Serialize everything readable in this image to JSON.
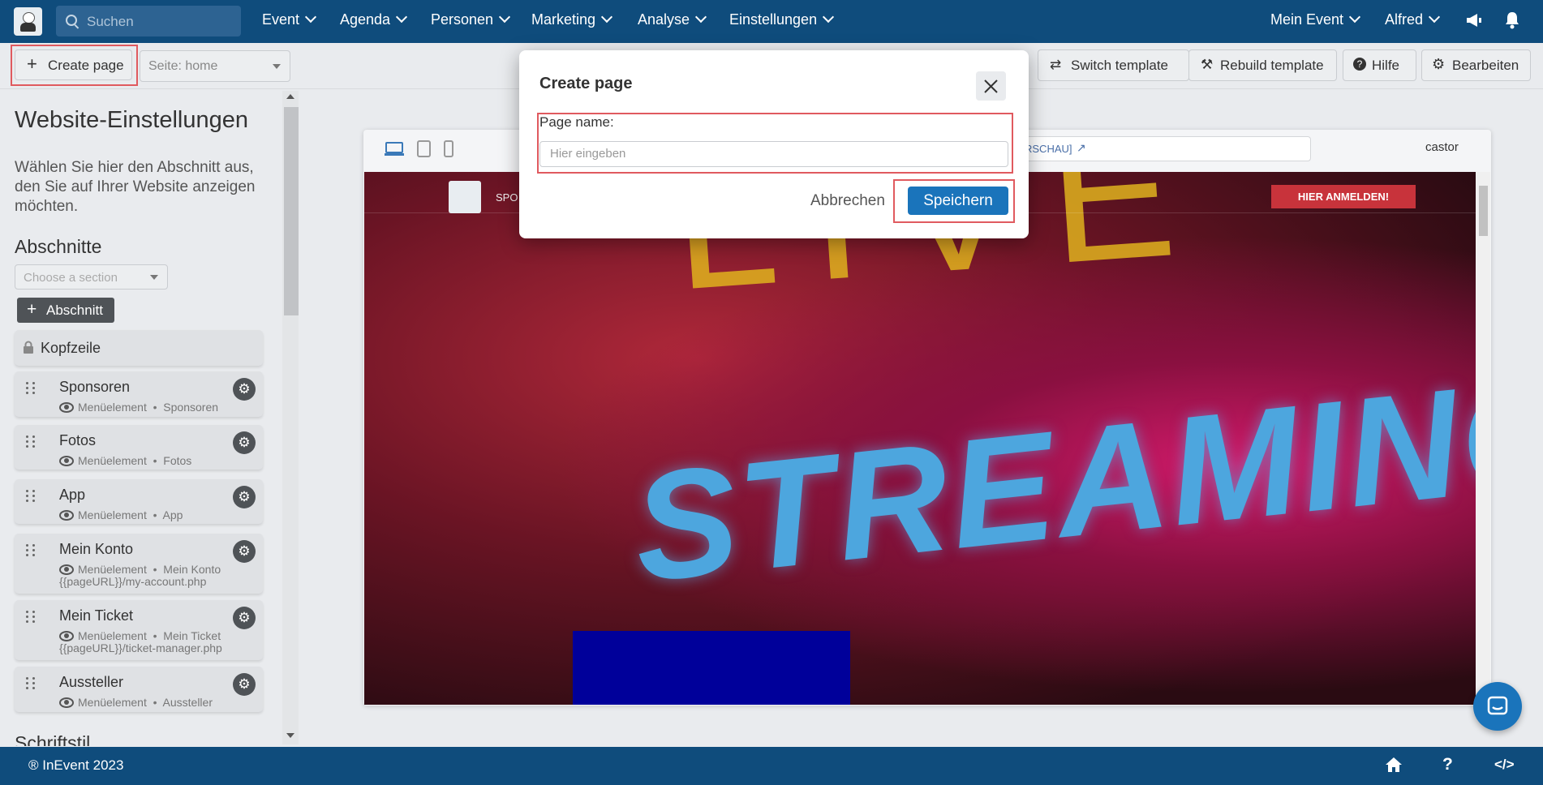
{
  "topbar": {
    "search_placeholder": "Suchen",
    "nav": [
      "Event",
      "Agenda",
      "Personen",
      "Marketing",
      "Analyse",
      "Einstellungen"
    ],
    "right": [
      "Mein Event",
      "Alfred"
    ]
  },
  "toolbar": {
    "create_page": "Create page",
    "page_select": "Seite: home",
    "switch_template": "Switch template",
    "rebuild_template": "Rebuild template",
    "help": "Hilfe",
    "edit": "Bearbeiten"
  },
  "sidebar": {
    "title": "Website-Einstellungen",
    "description": "Wählen Sie hier den Abschnitt aus, den Sie auf Ihrer Website anzeigen möchten.",
    "sections_heading": "Abschnitte",
    "section_select_placeholder": "Choose a section",
    "add_section": "Abschnitt",
    "header_item": "Kopfzeile",
    "items": [
      {
        "title": "Sponsoren",
        "type": "Menüelement",
        "target": "Sponsoren",
        "url": ""
      },
      {
        "title": "Fotos",
        "type": "Menüelement",
        "target": "Fotos",
        "url": ""
      },
      {
        "title": "App",
        "type": "Menüelement",
        "target": "App",
        "url": ""
      },
      {
        "title": "Mein Konto",
        "type": "Menüelement",
        "target": "Mein Konto",
        "url": "{{pageURL}}/my-account.php"
      },
      {
        "title": "Mein Ticket",
        "type": "Menüelement",
        "target": "Mein Ticket",
        "url": "{{pageURL}}/ticket-manager.php"
      },
      {
        "title": "Aussteller",
        "type": "Menüelement",
        "target": "Aussteller",
        "url": ""
      }
    ],
    "font_heading": "Schriftstil"
  },
  "preview": {
    "url_text": "RSCHAU]",
    "user": "castor",
    "site_nav_partial": "SPO",
    "register_button": "HIER ANMELDEN!",
    "hero_text_top": "LIVE",
    "hero_text_main": "STREAMING"
  },
  "modal": {
    "title": "Create page",
    "field_label": "Page name:",
    "field_placeholder": "Hier eingeben",
    "cancel": "Abbrechen",
    "save": "Speichern"
  },
  "footer": {
    "copyright": "® InEvent 2023"
  },
  "colors": {
    "topbar": "#0f4c7c",
    "primary_button": "#1a74bb",
    "highlight": "#e05a5f",
    "register_button": "#c8333b"
  }
}
